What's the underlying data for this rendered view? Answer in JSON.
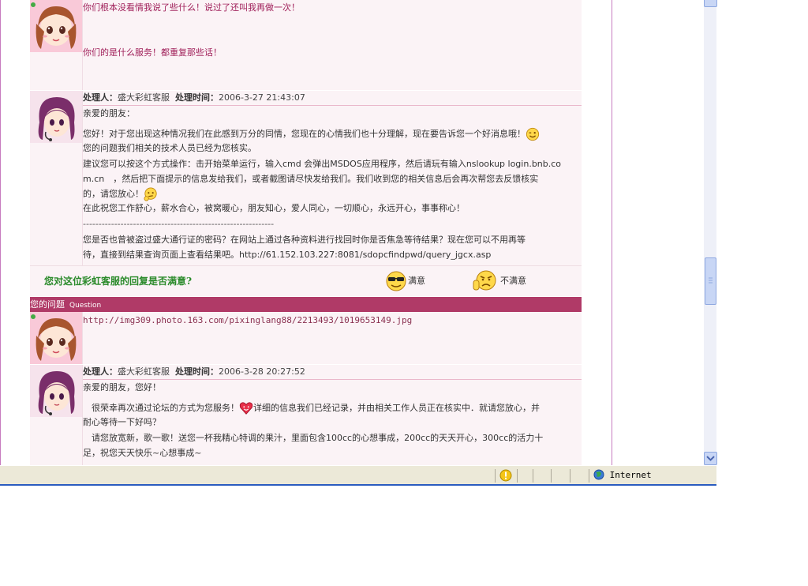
{
  "thread": {
    "user_msg_1": {
      "line1": "你们根本没看情我说了些什么！说过了还叫我再做一次！",
      "line2": "你们的是什么服务！都重复那些话！"
    },
    "reply_1": {
      "handler_label": "处理人：",
      "handler": "盛大彩虹客服",
      "time_label": "处理时间：",
      "time": "2006-3-27 21:43:07",
      "lines": [
        "亲爱的朋友：",
        "您好！对于您出现这种情况我们在此感到万分的同情，您现在的心情我们也十分理解，现在要告诉您一个好消息哦！",
        "您的问题我们相关的技术人员已经为您核实。",
        "建议您可以按这个方式操作：击开始菜单运行，输入cmd 会弹出MSDOS应用程序，然后请玩有输入nslookup login.bnb.co",
        "m.cn　，然后把下面提示的信息发给我们，或者截图请尽快发给我们。我们收到您的相关信息后会再次帮您去反馈核实",
        "的，请您放心！",
        "在此祝您工作舒心，薪水合心，被窝暖心，朋友知心，爱人同心，一切顺心，永远开心，事事称心！",
        "-------------------------------------------------------------",
        "您是否也曾被盗过盛大通行证的密码？在网站上通过各种资料进行找回时你是否焦急等待结果？现在您可以不用再等",
        "待，直接到结果查询页面上查看结果吧。http://61.152.103.227:8081/sdopcfindpwd/query_jgcx.asp"
      ]
    },
    "satisfaction": {
      "question": "您对这位彩虹客服的回复是否满意?",
      "satisfied": "满意",
      "unsatisfied": "不满意"
    },
    "question_bar": {
      "title": "您的问题",
      "subtitle": "Question"
    },
    "user_msg_2": {
      "url": "http://img309.photo.163.com/pixinglang88/2213493/1019653149.jpg"
    },
    "reply_2": {
      "handler_label": "处理人：",
      "handler": "盛大彩虹客服",
      "time_label": "处理时间：",
      "time": "2006-3-28 20:27:52",
      "lines": [
        "亲爱的朋友，您好！",
        "　很荣幸再次通过论坛的方式为您服务！",
        "详细的信息我们已经记录，并由相关工作人员正在核实中．就请您放心，并",
        "耐心等待一下好吗？",
        "　请您放宽新，歌一歌！送您一杯我精心特调的果汁，里面包含100cc的心想事成，200cc的天天开心，300cc的活力十",
        "足，祝您天天快乐~心想事成~"
      ]
    }
  },
  "status_bar": {
    "zone": "Internet"
  },
  "colors": {
    "accent_bar": "#b03a67",
    "satisfaction_question": "#2a8a2a",
    "cell_bg": "#fbf3f6"
  }
}
